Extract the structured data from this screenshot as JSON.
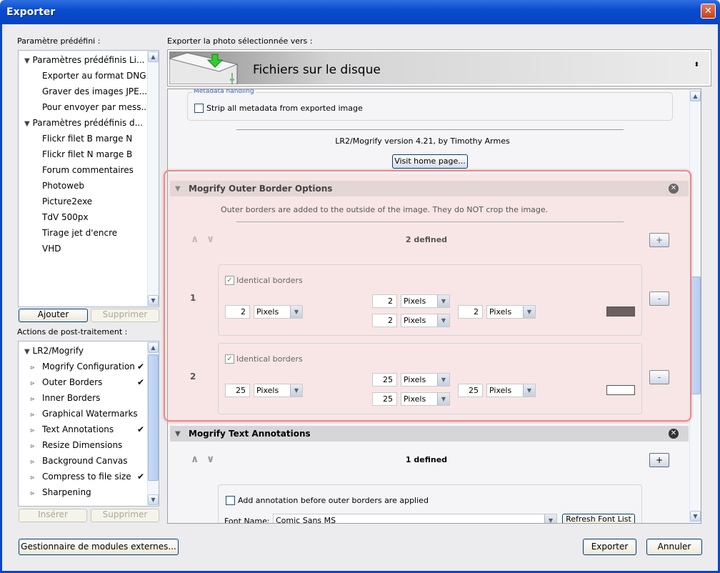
{
  "window": {
    "title": "Exporter",
    "close": "✕"
  },
  "left": {
    "preset_label": "Paramètre prédéfini :",
    "presets": [
      {
        "label": "Paramètres prédéfinis Li...",
        "group": true
      },
      {
        "label": "Exporter au format DNG"
      },
      {
        "label": "Graver des images JPE..."
      },
      {
        "label": "Pour envoyer par mess..."
      },
      {
        "label": "Paramètres prédéfinis d...",
        "group": true
      },
      {
        "label": "Flickr filet B marge N"
      },
      {
        "label": "Flickr filet N marge B"
      },
      {
        "label": "Forum commentaires"
      },
      {
        "label": "Photoweb"
      },
      {
        "label": "Picture2exe"
      },
      {
        "label": "TdV 500px"
      },
      {
        "label": "Tirage jet d'encre"
      },
      {
        "label": "VHD"
      }
    ],
    "add_label": "Ajouter",
    "remove_label": "Supprimer",
    "actions_label": "Actions de post-traitement :",
    "actions": [
      {
        "label": "LR2/Mogrify",
        "group": true,
        "checked": false
      },
      {
        "label": "Mogrify Configuration",
        "checked": true
      },
      {
        "label": "Outer Borders",
        "checked": true
      },
      {
        "label": "Inner Borders",
        "checked": false
      },
      {
        "label": "Graphical Watermarks",
        "checked": false
      },
      {
        "label": "Text Annotations",
        "checked": true
      },
      {
        "label": "Resize Dimensions",
        "checked": false
      },
      {
        "label": "Background Canvas",
        "checked": false
      },
      {
        "label": "Compress to file size",
        "checked": true
      },
      {
        "label": "Sharpening",
        "checked": false
      }
    ],
    "insert_label": "Insérer",
    "remove2_label": "Supprimer",
    "plugin_manager_label": "Gestionnaire de modules externes..."
  },
  "right": {
    "dest_label": "Exporter la photo sélectionnée vers :",
    "dest_value": "Fichiers sur le disque",
    "metadata": {
      "legend": "Metadata handling",
      "strip_label": "Strip all metadata from exported image",
      "strip_checked": false
    },
    "version_text": "LR2/Mogrify version 4.21, by Timothy Armes",
    "visit_label": "Visit home page...",
    "outer": {
      "title": "Mogrify Outer Border Options",
      "desc": "Outer borders are added to the outside of the image.  They do NOT crop the image.",
      "count": "2 defined",
      "add": "+",
      "borders": [
        {
          "index": "1",
          "identical_label": "Identical borders",
          "identical": true,
          "left": "2",
          "top": "2",
          "bottom": "2",
          "right": "2",
          "unit": "Pixels",
          "color": "#6e6060",
          "remove": "-"
        },
        {
          "index": "2",
          "identical_label": "Identical borders",
          "identical": true,
          "left": "25",
          "top": "25",
          "bottom": "25",
          "right": "25",
          "unit": "Pixels",
          "color": "#ffffff",
          "remove": "-"
        }
      ]
    },
    "text": {
      "title": "Mogrify Text Annotations",
      "count": "1 defined",
      "add": "+",
      "before_label": "Add annotation before outer borders are applied",
      "font_label": "Font Name:",
      "font_value": "Comic Sans MS",
      "refresh_label": "Refresh Font List"
    }
  },
  "footer": {
    "export_label": "Exporter",
    "cancel_label": "Annuler"
  },
  "colors": {
    "title_bar": "#0a4ccf",
    "highlight": "#f08080",
    "pink_bg": "#f8e6e6"
  }
}
